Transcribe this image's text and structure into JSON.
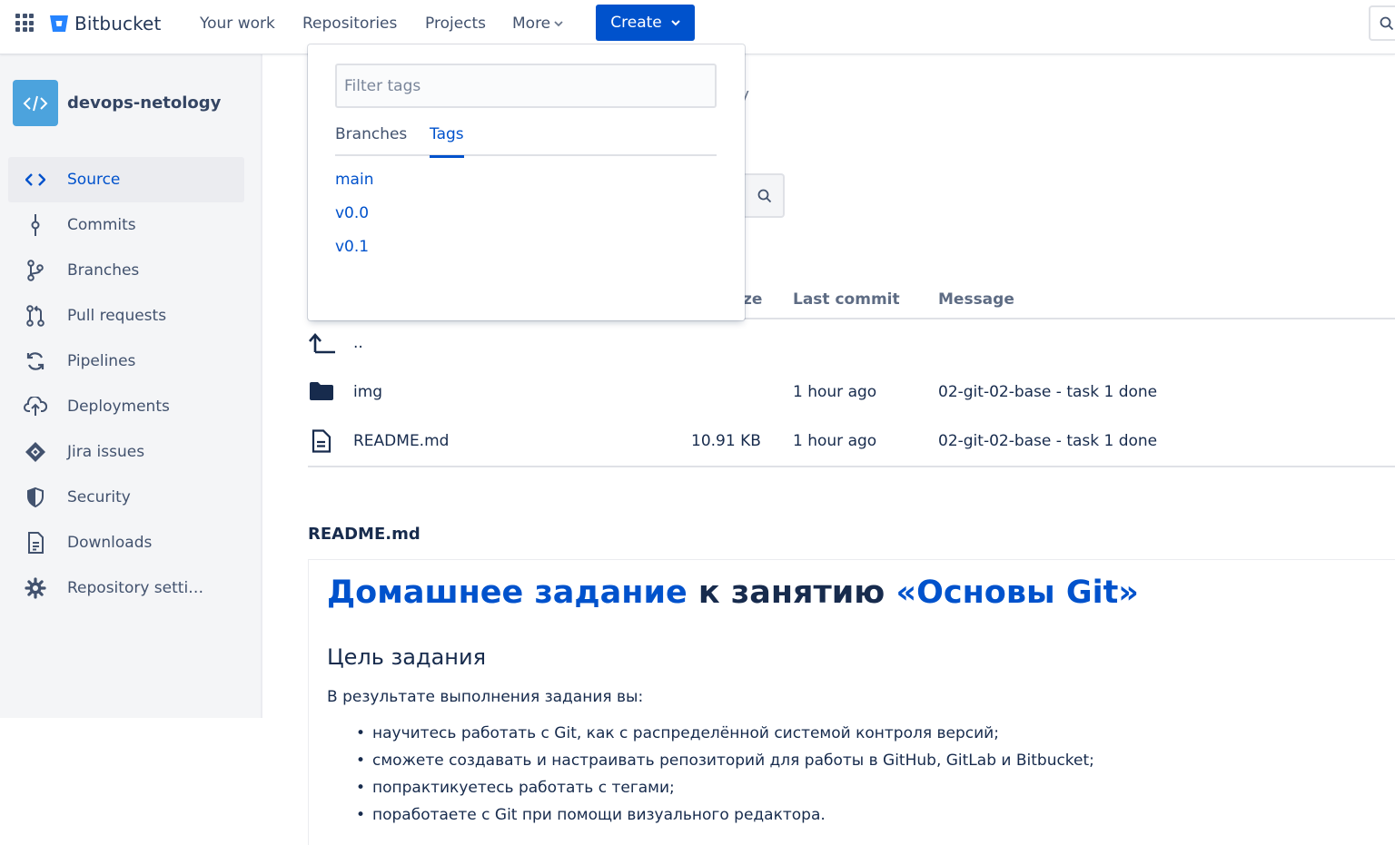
{
  "topnav": {
    "brand": "Bitbucket",
    "links": [
      "Your work",
      "Repositories",
      "Projects",
      "More"
    ],
    "create_label": "Create",
    "accent": "#0052cc"
  },
  "sidebar": {
    "repo_name": "devops-netology",
    "items": [
      {
        "label": "Source",
        "icon": "code-icon",
        "active": true
      },
      {
        "label": "Commits",
        "icon": "commit-icon"
      },
      {
        "label": "Branches",
        "icon": "branch-icon"
      },
      {
        "label": "Pull requests",
        "icon": "pull-request-icon"
      },
      {
        "label": "Pipelines",
        "icon": "pipelines-icon"
      },
      {
        "label": "Deployments",
        "icon": "cloud-upload-icon"
      },
      {
        "label": "Jira issues",
        "icon": "jira-icon"
      },
      {
        "label": "Security",
        "icon": "shield-icon"
      },
      {
        "label": "Downloads",
        "icon": "document-icon"
      },
      {
        "label": "Repository setti…",
        "icon": "gear-icon"
      }
    ]
  },
  "dropdown": {
    "filter_placeholder": "Filter tags",
    "tabs": [
      "Branches",
      "Tags"
    ],
    "active_tab": "Tags",
    "items": [
      "main",
      "v0.0",
      "v0.1"
    ]
  },
  "main": {
    "partial_text": "gy",
    "table": {
      "headers": {
        "size": "ze",
        "last_commit": "Last commit",
        "message": "Message"
      },
      "parent": "..",
      "rows": [
        {
          "name": "img",
          "type": "folder",
          "size": "",
          "last_commit": "1 hour ago",
          "message": "02-git-02-base - task 1 done"
        },
        {
          "name": "README.md",
          "type": "file",
          "size": "10.91 KB",
          "last_commit": "1 hour ago",
          "message": "02-git-02-base - task 1 done"
        }
      ]
    },
    "readme": {
      "filename": "README.md",
      "h1_link1": "Домашнее задание",
      "h1_middle": " к занятию ",
      "h1_link2": "«Основы Git»",
      "h2": "Цель задания",
      "intro": "В результате выполнения задания вы:",
      "bullets": [
        "научитесь работать с Git, как с распределённой системой контроля версий;",
        "сможете создавать и настраивать репозиторий для работы в GitHub, GitLab и Bitbucket;",
        "попрактикуетесь работать с тегами;",
        "поработаете с Git при помощи визуального редактора."
      ]
    }
  }
}
